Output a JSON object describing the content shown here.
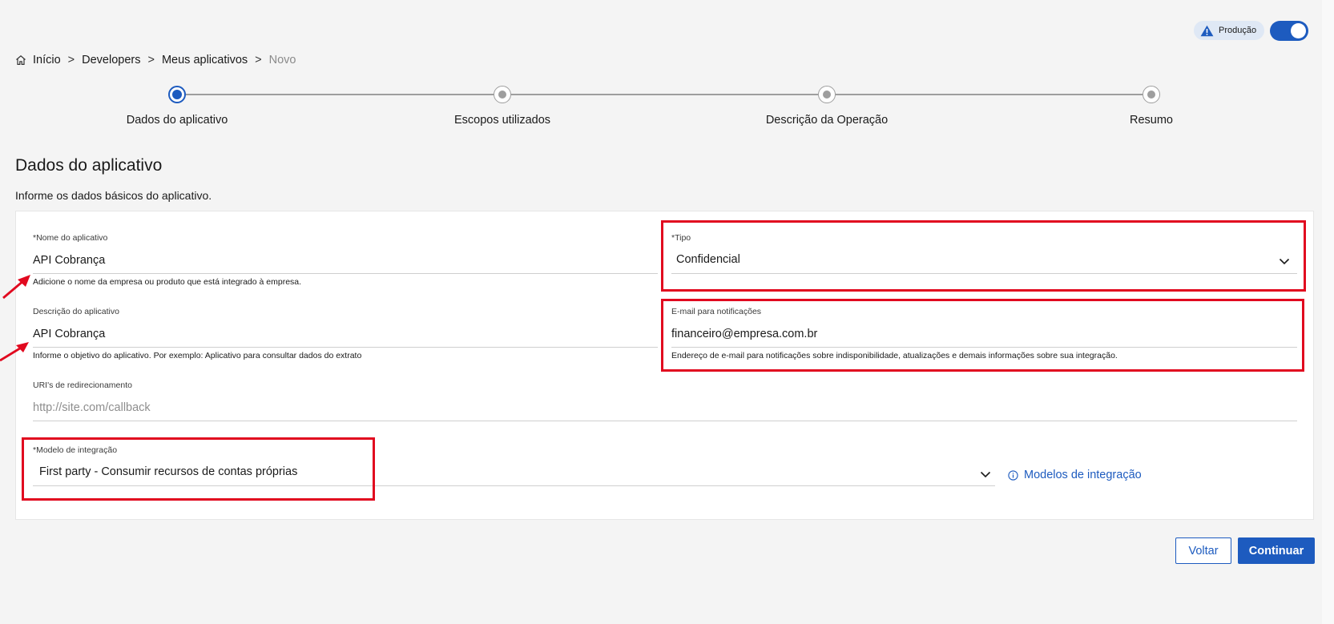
{
  "environment": {
    "badge_label": "Produção",
    "toggle_on": true
  },
  "breadcrumb": {
    "items": [
      "Início",
      "Developers",
      "Meus aplicativos"
    ],
    "current": "Novo",
    "separator": ">"
  },
  "stepper": {
    "steps": [
      {
        "label": "Dados do aplicativo",
        "active": true
      },
      {
        "label": "Escopos utilizados",
        "active": false
      },
      {
        "label": "Descrição da Operação",
        "active": false
      },
      {
        "label": "Resumo",
        "active": false
      }
    ]
  },
  "page": {
    "title": "Dados do aplicativo",
    "subtitle": "Informe os dados básicos do aplicativo."
  },
  "form": {
    "app_name": {
      "label": "*Nome do aplicativo",
      "value": "API Cobrança",
      "helper": "Adicione o nome da empresa ou produto que está integrado à empresa."
    },
    "app_description": {
      "label": "Descrição do aplicativo",
      "value": "API Cobrança",
      "helper": "Informe o objetivo do aplicativo. Por exemplo: Aplicativo para consultar dados do extrato"
    },
    "redirect_uris": {
      "label": "URI's de redirecionamento",
      "placeholder": "http://site.com/callback"
    },
    "type": {
      "label": "*Tipo",
      "value": "Confidencial"
    },
    "notification_email": {
      "label": "E-mail para notificações",
      "value": "financeiro@empresa.com.br",
      "helper": "Endereço de e-mail para notificações sobre indisponibilidade, atualizações e demais informações sobre sua integração."
    },
    "integration_model": {
      "label": "*Modelo de integração",
      "value": "First party - Consumir recursos de contas próprias"
    },
    "integration_models_link": "Modelos de integração"
  },
  "actions": {
    "back_label": "Voltar",
    "continue_label": "Continuar"
  },
  "colors": {
    "primary": "#1d5bbf",
    "highlight": "#e1091f",
    "badge_bg": "#dfe8f5"
  }
}
